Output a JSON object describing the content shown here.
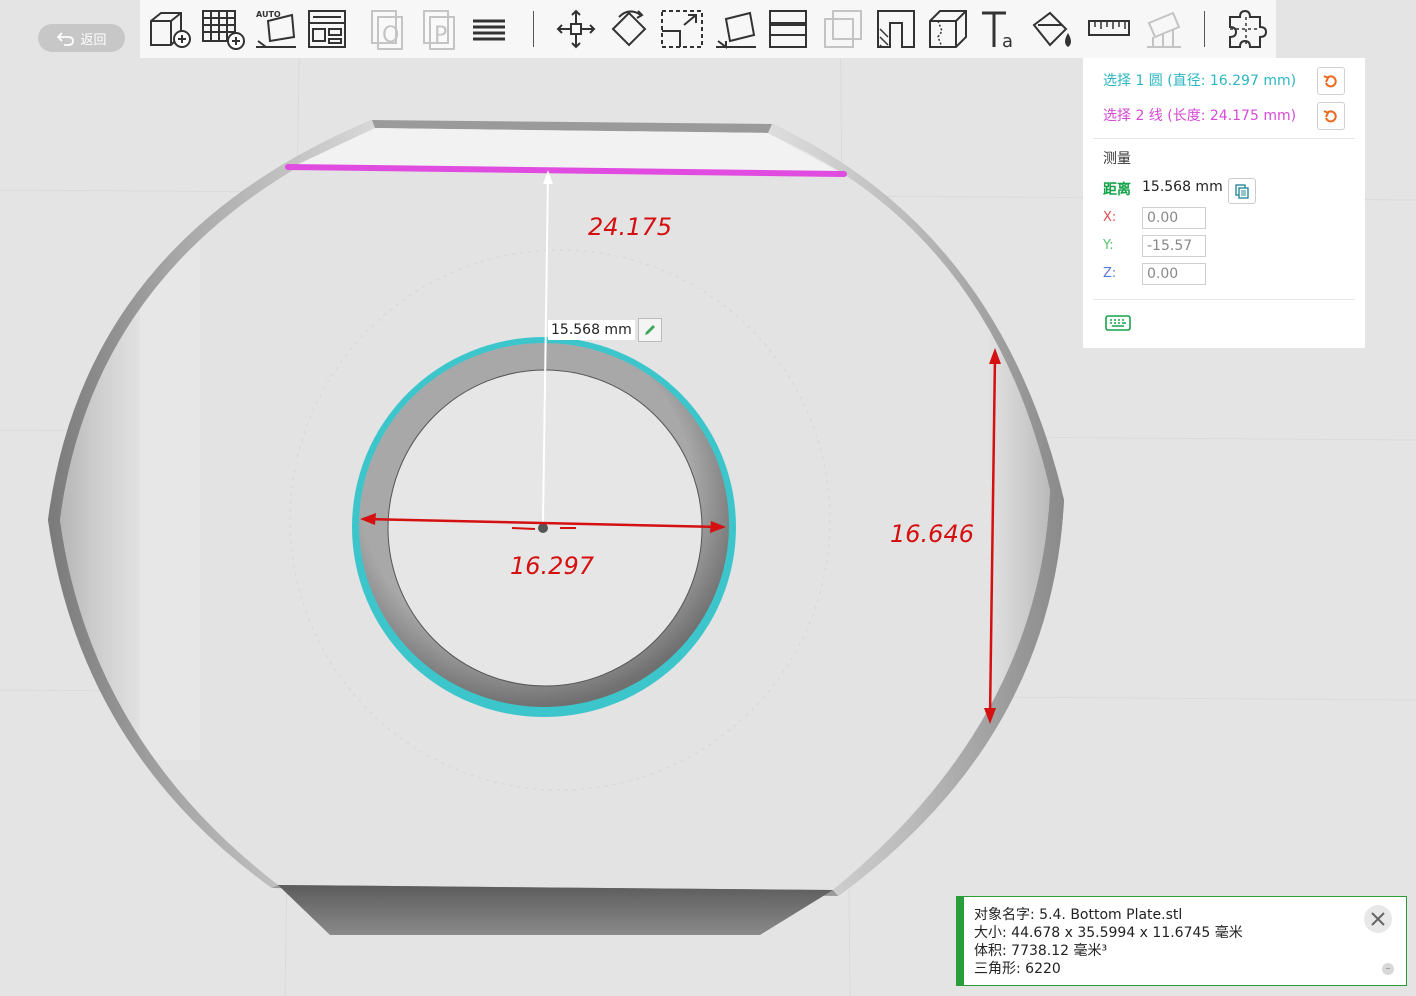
{
  "nav": {
    "back_label": "返回"
  },
  "toolbar": {
    "tools": [
      {
        "name": "add-cube-icon",
        "enabled": true
      },
      {
        "name": "add-grid-icon",
        "enabled": true
      },
      {
        "name": "auto-layout-icon",
        "enabled": true,
        "badge": "AUTO"
      },
      {
        "name": "layout-icon",
        "enabled": true
      },
      {
        "name": "copy-o-icon",
        "enabled": false,
        "glyph": "O"
      },
      {
        "name": "copy-p-icon",
        "enabled": false,
        "glyph": "P"
      },
      {
        "name": "layers-icon",
        "enabled": true
      },
      {
        "name": "move-icon",
        "enabled": true
      },
      {
        "name": "rotate-icon",
        "enabled": true
      },
      {
        "name": "scale-icon",
        "enabled": true
      },
      {
        "name": "lay-flat-icon",
        "enabled": true
      },
      {
        "name": "cut-icon",
        "enabled": true
      },
      {
        "name": "hollow-icon",
        "enabled": false
      },
      {
        "name": "shell-icon",
        "enabled": true
      },
      {
        "name": "split-icon",
        "enabled": true
      },
      {
        "name": "text-icon",
        "enabled": true,
        "glyph": "Ta"
      },
      {
        "name": "paint-icon",
        "enabled": true
      },
      {
        "name": "measure-ruler-icon",
        "enabled": true
      },
      {
        "name": "support-icon",
        "enabled": false
      },
      {
        "name": "puzzle-icon",
        "enabled": true
      }
    ]
  },
  "measure": {
    "selection1": "选择 1 圆 (直径: 16.297 mm)",
    "selection2": "选择 2 线 (长度: 24.175 mm)",
    "section_title": "测量",
    "distance_label": "距离",
    "distance_value": "15.568 mm",
    "x_label": "X:",
    "x_value": "0.00",
    "y_label": "Y:",
    "y_value": "-15.57",
    "z_label": "Z:",
    "z_value": "0.00",
    "colors": {
      "selection1": "#2bb7c2",
      "selection2": "#d64ad6",
      "distance": "#15a34a",
      "x": "#e05050",
      "y": "#58c070",
      "z": "#5a7ad8",
      "reset": "#ea6a1f"
    }
  },
  "viewport": {
    "distance_label": "15.568 mm",
    "dim_line_length": "24.175",
    "dim_circle_diameter": "16.297",
    "dim_side_height": "16.646"
  },
  "object_info": {
    "name_line": "对象名字:   5.4. Bottom Plate.stl",
    "size_line": "大小:   44.678 x 35.5994 x 11.6745 毫米",
    "volume_line": "体积:   7738.12 毫米³",
    "triangles_line": "三角形:   6220",
    "close_icon": "close-icon",
    "minimize_icon": "minimize-icon"
  }
}
